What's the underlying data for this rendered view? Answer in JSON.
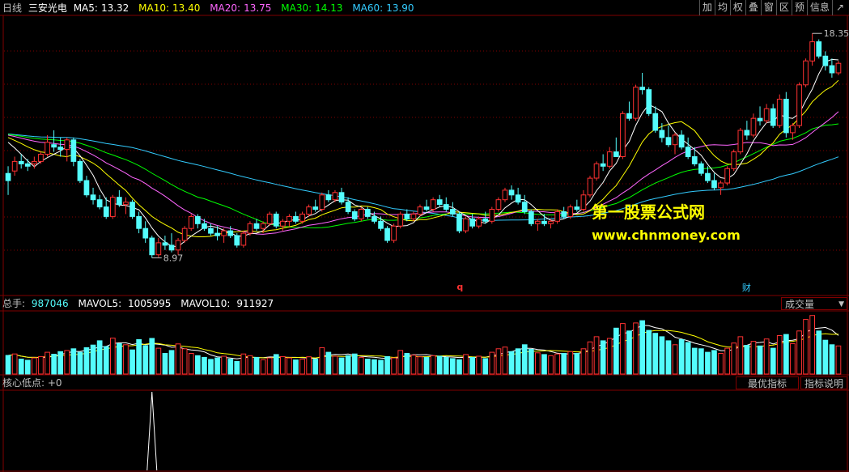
{
  "header": {
    "period": "日线",
    "stock_name": "三安光电",
    "ma": [
      {
        "label": "MA5:",
        "value": "13.32",
        "color": "#ffffff"
      },
      {
        "label": "MA10:",
        "value": "13.40",
        "color": "#ffff00"
      },
      {
        "label": "MA20:",
        "value": "13.75",
        "color": "#ff66ff"
      },
      {
        "label": "MA30:",
        "value": "14.13",
        "color": "#00ff00"
      },
      {
        "label": "MA60:",
        "value": "13.90",
        "color": "#33ccff"
      }
    ]
  },
  "toolbar": {
    "b1": "加",
    "b2": "均",
    "b3": "权",
    "b4": "叠",
    "b5": "窗",
    "b6": "区",
    "b7": "预",
    "info": "信息",
    "arrow_icon": "↗"
  },
  "annotations": {
    "high": "18.35",
    "low": "8.97",
    "marker_q": "q",
    "marker_cai": "财"
  },
  "watermark": {
    "line1": "第一股票公式网",
    "line2": "www.chnmoney.com"
  },
  "volume": {
    "total_label": "总手:",
    "total_value": "987046",
    "mavol5_label": "MAVOL5:",
    "mavol5_value": "1005995",
    "mavol10_label": "MAVOL10:",
    "mavol10_value": "911927",
    "selector": "成交量"
  },
  "indicator": {
    "label": "核心低点: +0",
    "best_button": "最优指标",
    "help_button": "指标说明"
  },
  "colors": {
    "up": "#ff3232",
    "down": "#54fcfc",
    "grid": "#7f0000",
    "ma5": "#ffffff",
    "ma10": "#ffff00",
    "ma20": "#ff66ff",
    "ma30": "#00ff00",
    "ma60": "#33ccff",
    "vol_ma5": "#ffffff",
    "vol_ma10": "#ffff00"
  },
  "chart_data": {
    "type": "candlestick",
    "price_range": [
      7.5,
      19.0
    ],
    "candles": [
      [
        12.5,
        12.8,
        11.6,
        12.2
      ],
      [
        12.6,
        13.2,
        12.4,
        13.0
      ],
      [
        13.0,
        13.3,
        12.7,
        12.9
      ],
      [
        12.9,
        13.1,
        12.6,
        12.8
      ],
      [
        12.9,
        13.2,
        12.7,
        13.0
      ],
      [
        13.0,
        13.4,
        12.9,
        13.3
      ],
      [
        13.3,
        14.1,
        13.2,
        13.8
      ],
      [
        13.7,
        14.3,
        13.4,
        13.6
      ],
      [
        13.6,
        14.0,
        13.2,
        13.5
      ],
      [
        13.5,
        14.0,
        13.0,
        13.9
      ],
      [
        13.9,
        14.0,
        12.8,
        13.0
      ],
      [
        13.0,
        13.1,
        12.1,
        12.2
      ],
      [
        12.2,
        12.4,
        11.5,
        11.6
      ],
      [
        11.6,
        11.9,
        11.2,
        11.4
      ],
      [
        11.4,
        11.6,
        11.0,
        11.1
      ],
      [
        11.1,
        11.5,
        10.6,
        10.7
      ],
      [
        10.7,
        11.6,
        10.6,
        11.5
      ],
      [
        11.5,
        11.8,
        11.1,
        11.2
      ],
      [
        11.2,
        11.5,
        10.8,
        11.3
      ],
      [
        11.3,
        11.4,
        10.6,
        10.7
      ],
      [
        10.7,
        10.9,
        10.0,
        10.2
      ],
      [
        10.2,
        10.5,
        9.6,
        9.8
      ],
      [
        9.8,
        9.9,
        8.97,
        9.1
      ],
      [
        9.1,
        9.8,
        9.0,
        9.6
      ],
      [
        9.6,
        9.9,
        9.3,
        9.5
      ],
      [
        9.5,
        10.0,
        9.2,
        9.3
      ],
      [
        9.3,
        9.8,
        9.1,
        9.7
      ],
      [
        9.7,
        10.3,
        9.6,
        10.2
      ],
      [
        10.2,
        10.8,
        10.1,
        10.7
      ],
      [
        10.7,
        10.8,
        10.2,
        10.4
      ],
      [
        10.4,
        10.6,
        10.1,
        10.2
      ],
      [
        10.2,
        10.4,
        9.9,
        10.0
      ],
      [
        10.0,
        10.3,
        9.7,
        9.9
      ],
      [
        9.9,
        10.2,
        9.6,
        10.1
      ],
      [
        10.1,
        10.3,
        9.8,
        9.9
      ],
      [
        9.9,
        10.0,
        9.4,
        9.5
      ],
      [
        9.5,
        10.1,
        9.4,
        10.0
      ],
      [
        10.0,
        10.5,
        9.9,
        10.4
      ],
      [
        10.4,
        10.6,
        10.1,
        10.2
      ],
      [
        10.2,
        10.5,
        10.0,
        10.4
      ],
      [
        10.4,
        10.9,
        10.3,
        10.8
      ],
      [
        10.8,
        10.9,
        10.2,
        10.3
      ],
      [
        10.3,
        10.6,
        10.1,
        10.5
      ],
      [
        10.5,
        10.8,
        10.3,
        10.7
      ],
      [
        10.7,
        10.9,
        10.4,
        10.5
      ],
      [
        10.5,
        10.9,
        10.4,
        10.8
      ],
      [
        10.8,
        11.2,
        10.7,
        11.1
      ],
      [
        11.1,
        11.4,
        10.9,
        11.0
      ],
      [
        11.0,
        11.7,
        10.9,
        11.6
      ],
      [
        11.6,
        11.8,
        11.3,
        11.4
      ],
      [
        11.4,
        11.8,
        11.3,
        11.7
      ],
      [
        11.7,
        11.9,
        11.2,
        11.3
      ],
      [
        11.3,
        11.5,
        10.8,
        10.9
      ],
      [
        10.9,
        11.0,
        10.5,
        10.6
      ],
      [
        10.6,
        11.1,
        10.5,
        11.0
      ],
      [
        11.0,
        11.1,
        10.6,
        10.7
      ],
      [
        10.7,
        10.9,
        10.4,
        10.5
      ],
      [
        10.5,
        10.7,
        10.1,
        10.2
      ],
      [
        10.2,
        10.3,
        9.6,
        9.7
      ],
      [
        9.7,
        10.4,
        9.6,
        10.3
      ],
      [
        10.3,
        10.9,
        10.2,
        10.8
      ],
      [
        10.8,
        11.0,
        10.5,
        10.6
      ],
      [
        10.6,
        10.9,
        10.5,
        10.8
      ],
      [
        10.8,
        11.2,
        10.7,
        11.1
      ],
      [
        11.1,
        11.4,
        10.9,
        11.0
      ],
      [
        11.0,
        11.5,
        10.9,
        11.4
      ],
      [
        11.4,
        11.6,
        11.1,
        11.2
      ],
      [
        11.2,
        11.5,
        10.9,
        11.0
      ],
      [
        11.0,
        11.3,
        10.7,
        10.8
      ],
      [
        10.8,
        10.9,
        10.0,
        10.1
      ],
      [
        10.1,
        10.7,
        10.0,
        10.6
      ],
      [
        10.6,
        10.8,
        10.2,
        10.3
      ],
      [
        10.3,
        10.7,
        10.2,
        10.6
      ],
      [
        10.6,
        10.9,
        10.4,
        10.5
      ],
      [
        10.5,
        11.1,
        10.4,
        11.0
      ],
      [
        11.0,
        11.5,
        10.9,
        11.4
      ],
      [
        11.4,
        11.9,
        11.3,
        11.8
      ],
      [
        11.8,
        12.0,
        11.4,
        11.6
      ],
      [
        11.6,
        11.9,
        11.2,
        11.3
      ],
      [
        11.3,
        11.6,
        10.8,
        10.9
      ],
      [
        10.9,
        11.0,
        10.3,
        10.4
      ],
      [
        10.4,
        10.6,
        10.1,
        10.5
      ],
      [
        10.5,
        10.8,
        10.3,
        10.4
      ],
      [
        10.4,
        10.6,
        10.2,
        10.5
      ],
      [
        10.5,
        11.0,
        10.4,
        10.9
      ],
      [
        10.9,
        11.1,
        10.6,
        10.7
      ],
      [
        10.7,
        11.2,
        10.6,
        11.1
      ],
      [
        11.1,
        11.4,
        10.9,
        11.0
      ],
      [
        11.0,
        11.8,
        10.9,
        11.6
      ],
      [
        11.6,
        12.4,
        11.5,
        12.3
      ],
      [
        12.3,
        13.0,
        12.2,
        12.9
      ],
      [
        12.9,
        13.3,
        12.6,
        12.8
      ],
      [
        12.8,
        13.6,
        12.7,
        13.4
      ],
      [
        13.4,
        14.0,
        13.3,
        13.2
      ],
      [
        13.2,
        15.1,
        13.1,
        15.0
      ],
      [
        15.0,
        15.5,
        14.7,
        14.8
      ],
      [
        14.8,
        16.2,
        14.7,
        16.1
      ],
      [
        16.1,
        16.7,
        15.8,
        16.0
      ],
      [
        16.0,
        16.1,
        14.9,
        15.0
      ],
      [
        15.0,
        15.3,
        14.2,
        14.3
      ],
      [
        14.3,
        14.6,
        13.8,
        14.0
      ],
      [
        14.0,
        14.5,
        13.6,
        13.7
      ],
      [
        13.7,
        14.2,
        13.3,
        14.1
      ],
      [
        14.1,
        14.3,
        13.5,
        13.6
      ],
      [
        13.6,
        14.0,
        13.1,
        13.2
      ],
      [
        13.2,
        13.6,
        12.8,
        12.9
      ],
      [
        12.9,
        13.0,
        12.4,
        12.5
      ],
      [
        12.5,
        12.8,
        12.1,
        12.2
      ],
      [
        12.2,
        12.5,
        11.8,
        11.9
      ],
      [
        11.9,
        12.2,
        11.6,
        12.1
      ],
      [
        12.1,
        12.8,
        12.0,
        12.7
      ],
      [
        12.7,
        13.5,
        12.6,
        13.4
      ],
      [
        13.4,
        14.4,
        13.3,
        14.3
      ],
      [
        14.3,
        14.7,
        13.9,
        14.1
      ],
      [
        14.1,
        15.0,
        14.0,
        14.8
      ],
      [
        14.8,
        15.3,
        14.5,
        14.7
      ],
      [
        14.7,
        15.4,
        14.6,
        15.2
      ],
      [
        15.2,
        15.4,
        14.4,
        14.5
      ],
      [
        14.5,
        15.8,
        14.4,
        15.6
      ],
      [
        15.6,
        15.9,
        14.0,
        14.2
      ],
      [
        14.2,
        14.6,
        13.9,
        14.5
      ],
      [
        14.5,
        16.3,
        14.4,
        16.2
      ],
      [
        16.2,
        17.3,
        16.1,
        17.2
      ],
      [
        17.2,
        18.35,
        17.0,
        18.0
      ],
      [
        18.0,
        18.1,
        17.3,
        17.4
      ],
      [
        17.4,
        17.6,
        16.8,
        17.0
      ],
      [
        17.0,
        17.3,
        16.5,
        16.7
      ],
      [
        16.7,
        17.2,
        16.6,
        17.1
      ]
    ],
    "volume_range": [
      0,
      2200000
    ],
    "volumes": [
      650000,
      700000,
      520000,
      480000,
      560000,
      610000,
      760000,
      690000,
      780000,
      820000,
      880000,
      760000,
      920000,
      1010000,
      1160000,
      960000,
      1250000,
      1060000,
      1020000,
      840000,
      1200000,
      990000,
      1240000,
      900000,
      720000,
      820000,
      1050000,
      880000,
      720000,
      640000,
      580000,
      510000,
      560000,
      620000,
      520000,
      440000,
      700000,
      640000,
      580000,
      500000,
      560000,
      680000,
      610000,
      560000,
      490000,
      520000,
      600000,
      520000,
      920000,
      760000,
      620000,
      560000,
      640000,
      700000,
      580000,
      520000,
      500000,
      480000,
      610000,
      560000,
      820000,
      720000,
      660000,
      600000,
      580000,
      640000,
      620000,
      580000,
      540000,
      500000,
      680000,
      580000,
      620000,
      540000,
      760000,
      880000,
      940000,
      780000,
      880000,
      1020000,
      860000,
      740000,
      680000,
      640000,
      700000,
      720000,
      780000,
      720000,
      880000,
      1120000,
      1300000,
      1160000,
      1240000,
      1600000,
      1760000,
      1500000,
      1780000,
      1860000,
      1520000,
      1420000,
      1300000,
      1160000,
      1020000,
      1200000,
      1100000,
      900000,
      880000,
      760000,
      820000,
      720000,
      900000,
      1080000,
      1300000,
      1000000,
      1140000,
      980000,
      1220000,
      900000,
      1340000,
      1380000,
      1060000,
      1500000,
      1900000,
      2040000,
      1500000,
      1180000,
      1020000,
      980000
    ],
    "indicator": {
      "label": "核心低点",
      "value": 0,
      "signal_index": 22
    }
  }
}
